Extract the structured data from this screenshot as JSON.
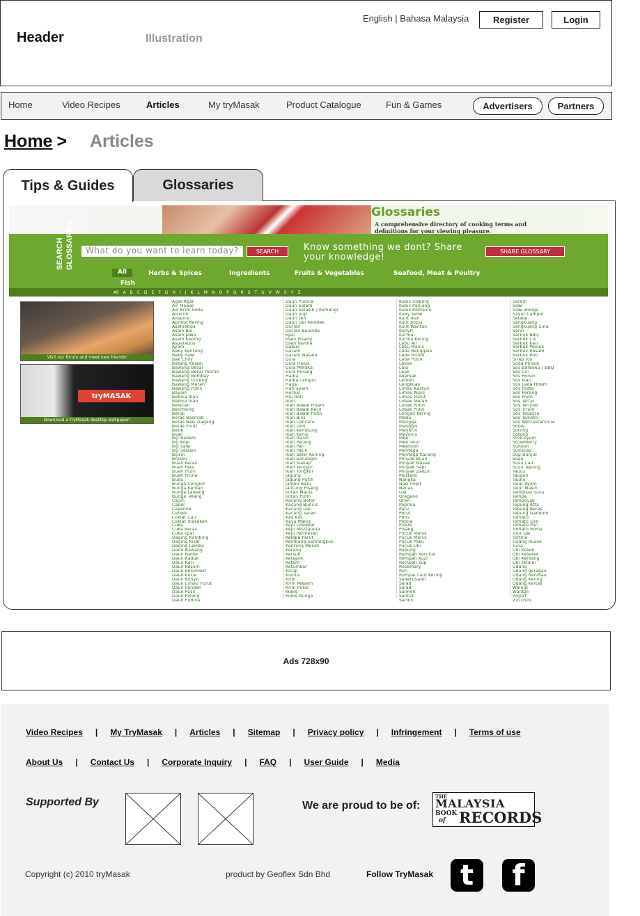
{
  "header": {
    "title": "Header",
    "illustration": "Illustration",
    "lang_english": "English",
    "lang_separator": "|",
    "lang_malay": "Bahasa Malaysia",
    "register_label": "Register",
    "login_label": "Login"
  },
  "nav": {
    "items": [
      "Home",
      "Video Recipes",
      "Articles",
      "My tryMasak",
      "Product Catalogue",
      "Fun & Games"
    ],
    "active": "Articles",
    "advertisers_label": "Advertisers",
    "partners_label": "Partners"
  },
  "breadcrumb": {
    "home": "Home",
    "separator": ">",
    "current": "Articles"
  },
  "tabs": {
    "active": "Tips & Guides",
    "inactive": "Glossaries"
  },
  "glossary": {
    "banner_title": "Glossaries",
    "banner_sub": "A comprehensive directory of cooking terms and definitions for your viewing pleasure.",
    "search_vertical": "SEARCH GLOSSARIES",
    "search_placeholder": "What do you want to learn today?",
    "search_button": "SEARCH",
    "know_text": "Know something we dont? Share your knowledge!",
    "share_button": "SHARE GLOSSARY",
    "categories": [
      "All",
      "Herbs & Spices",
      "Ingredients",
      "Fruits & Vegetables",
      "Seafood, Meat & Poultry",
      "Fish"
    ],
    "alphabet": [
      "All",
      "A",
      "B",
      "C",
      "D",
      "E",
      "F",
      "G",
      "H",
      "I",
      "J",
      "K",
      "L",
      "M",
      "N",
      "O",
      "P",
      "Q",
      "R",
      "S",
      "T",
      "U",
      "V",
      "W",
      "X",
      "Y",
      "Z"
    ],
    "side_caption_1": "Visit our forum and meet new friends!",
    "side_logo": "tryMASAK",
    "side_caption_2": "Download a TryMasak desktop wallpaper!",
    "columns": [
      [
        "Agar-Agar",
        "Air Mawar",
        "Ais Krim Soda",
        "Aiskrim",
        "Allspice",
        "Aprikot Kering",
        "Asafoetida",
        "Asam Boi",
        "Asam Jawa",
        "Asam Keping",
        "Asparagus",
        "Ayam",
        "Baby Kentang",
        "Baby Sawi",
        "Bak Choy",
        "Batang Keladi",
        "Bawang Besar",
        "Bawang Besar merah",
        "Bawang Bombay",
        "Bawang Goreng",
        "Bawang Merah",
        "Bawang Putih",
        "Bayam",
        "Bebola Ikan",
        "Bebola Ikan",
        "Belacan",
        "Belimbing",
        "Bendi",
        "Beras Basmati",
        "Beras Nasi Dagang",
        "Beras Pulut",
        "Betik",
        "Bijan",
        "Biji Badam",
        "Biji Kopi",
        "Biji Sawi",
        "Biji Selasih",
        "Bijirin",
        "Brokoli",
        "Buah Keras",
        "Buah Pala",
        "Buah Plum",
        "Buah Prune",
        "Budu",
        "Bunga Cengkih",
        "Bunga Kantan",
        "Bunga Lawang",
        "Bunga Telang",
        "Cajun",
        "Caper",
        "Cayenne",
        "Cendol",
        "Coklat Cair",
        "Coklat masakan",
        "Cuka",
        "Cuka Beras",
        "Cuka Epal",
        "Daging Kambing",
        "Daging Kisar",
        "Daging Lembu",
        "Daun Bawang",
        "Daun Halba",
        "Daun Kaduk",
        "Daun Kari",
        "Daun Kesum",
        "Daun Ketumbar",
        "Daun Kucai",
        "Daun Kunyit",
        "Daun Limau Purut",
        "Daun Pandan",
        "Daun Pasli",
        "Daun Pisang",
        "Daun Pudina"
      ],
      [
        "Daun Pudina",
        "Daun Salam",
        "Daun Selasih / Kemangi",
        "Daun Sup",
        "Daun Teh",
        "Daun Ubi Keledek",
        "Durian",
        "Durian Belanda",
        "Epal",
        "Esen Pisang",
        "Esen Vanilla",
        "Gabus",
        "Garam",
        "Garam Masala",
        "Gula",
        "Gula Halus",
        "Gula Melaka",
        "Gula Perang",
        "Halba",
        "Halba campur",
        "Halia",
        "Hati ayam",
        "Herbal",
        "Hiu Roti",
        "Ikan",
        "Ikan Bawal Hitam",
        "Ikan Bawal Kecil",
        "Ikan Bawal Putih",
        "Ikan Bilis",
        "Ikan Cencaru",
        "Ikan Dori",
        "Ikan Kembung",
        "Ikan Kerisi",
        "Ikan Masin",
        "Ikan Parang",
        "Ikan Pari",
        "Ikan Patin",
        "Ikan Selar Kuning",
        "Ikan Senangin",
        "Ikan Siakap",
        "Ikan Tenggiri",
        "Ikan Tongkol",
        "Jagung",
        "Jagung Putih",
        "Jambu Batu",
        "Jantung Pisang",
        "Jintan Manis",
        "Jintan Putih",
        "Kacang Botor",
        "Kacang Buncis",
        "Kacang Dal",
        "Kacang Tanah",
        "Kas Kas",
        "Kayu Manis",
        "Keju Cheddar",
        "Keju Mozzarella",
        "Keju Parmesan",
        "Kelapa Parut",
        "Kembang Semangkuk",
        "Kentang Merah",
        "Kerang",
        "Kerisik",
        "Ketapok",
        "Ketam",
        "Ketumbar",
        "Kicap",
        "Kismis",
        "Krim",
        "Krim Masam",
        "Krim Putar",
        "Kubis",
        "Kubis Bunga"
      ],
      [
        "Kubis Iceberg",
        "Kubis Panjang",
        "Kubis Romaine",
        "Kuey Teow",
        "Kulit Ikan",
        "Kulit popia",
        "Kulit Wantan",
        "Kunyit",
        "Kurma",
        "Kurma Kering",
        "Labu Air",
        "Labu Manis",
        "Lada Benggala",
        "Lada Hitam",
        "Lada Putih",
        "Laksa",
        "Lala",
        "Leek",
        "lelemak",
        "Lemon",
        "Lengkuas",
        "Limau Kasturi",
        "Limau Nipis",
        "Limau Purut",
        "Lobak Merah",
        "Lobak Putih",
        "Lobak Putik",
        "Longan Kering",
        "Madu",
        "Mangga",
        "Manggis",
        "Marjerin",
        "Mayonis",
        "Mee",
        "Mee Telur",
        "Meehoon",
        "Mentega",
        "Mentega Kacang",
        "Minyak Bijan",
        "Minyak Masak",
        "Minyak Sapi",
        "Minyak Zaitun",
        "Mustard",
        "Nangka",
        "Nasi Impit",
        "Nenas",
        "Oat",
        "Oregano",
        "Oren",
        "Paprika",
        "Paru",
        "Perut",
        "Petis",
        "Petola",
        "Pickle",
        "Pisang",
        "Pucuk Manis",
        "Pucuk Manis",
        "Pucuk Paku",
        "Pucuk Ubi",
        "Rebung",
        "Rempah Kerutuk",
        "Rempah Kuzi",
        "Rempah sup",
        "Rosemary",
        "Roti",
        "Rumpai Laut Kering",
        "Saderi/Sadri",
        "Salad",
        "Salad",
        "Salmon",
        "Santan",
        "Sardin"
      ],
      [
        "Sardin",
        "Sawi",
        "Sawi Bunga",
        "Sayur Campur",
        "Selada",
        "Sengkuang",
        "Sengkuang Cina",
        "Serai",
        "Serbuk BBQ",
        "Serbuk Cili",
        "Serbuk Kari",
        "Serbuk Penaik",
        "Serbuk Rasam",
        "Serbuk Roti",
        "Sirap ros",
        "Soda Penaik",
        "Sos Barbeku / BBQ",
        "Sos Cili",
        "Sos Hoisin",
        "Sos Ikan",
        "Sos Lada Hitam",
        "Sos Pasta",
        "Sos Perang",
        "Sos Plum",
        "Sos Tartar",
        "Sos Teriyaki",
        "Sos Tiram",
        "Sos Tobasco",
        "Sos Tomato",
        "Sos Worcestershire",
        "Sosej",
        "Sotong",
        "Sotong",
        "Stok Ayam",
        "Strawberry",
        "Suhoon",
        "Sultanas",
        "Sup Bunjut",
        "Susu",
        "Susu Cair",
        "Susu Tepung",
        "Taucu",
        "Taugeh",
        "Tauhu",
        "Telur Ayam",
        "Telur Masin",
        "Tembikai Susu",
        "Tempe",
        "Tempoyak",
        "Tepung Atta",
        "Tepung Beras",
        "Tepung Gandum",
        "Tomato",
        "Tomato Ceri",
        "Tomato Puri",
        "Tomato Roma",
        "Toor Dal",
        "Tortilla",
        "Tulang Rusuk",
        "Tuna",
        "Ubi Keladi",
        "Ubi Keledek",
        "Ubi Kentang",
        "Ubi Tetalai",
        "Udang",
        "Udang geragau",
        "Udang harimau",
        "Udang Kering",
        "Udang Kertas",
        "Walnut",
        "Wantan",
        "Yogurt",
        "Zucchini"
      ]
    ]
  },
  "ads_label": "Ads 728x90",
  "footer": {
    "row1": [
      "Video Recipes",
      "My TryMasak",
      "Articles",
      "Sitemap",
      "Privacy policy",
      "Infringement",
      "Terms of use"
    ],
    "row2": [
      "About Us",
      "Contact Us",
      "Corporate Inquiry",
      "FAQ",
      "User Guide",
      "Media"
    ],
    "separator": "|",
    "supported_by": "Supported By",
    "proud": "We are proud to be of:",
    "mbr_the": "THE",
    "mbr_malaysia": "MALAYSIA",
    "mbr_book": "BOOK",
    "mbr_of": "of",
    "mbr_records": "RECORDS",
    "copyright": "Copyright (c) 2010 tryMasak",
    "product_by": "product by Geoflex Sdn Bhd",
    "follow": "Follow TryMasak",
    "twitter_glyph": "t",
    "facebook_glyph": "f"
  },
  "icons": [
    "twitter-icon",
    "facebook-icon",
    "image-placeholder-icon"
  ]
}
